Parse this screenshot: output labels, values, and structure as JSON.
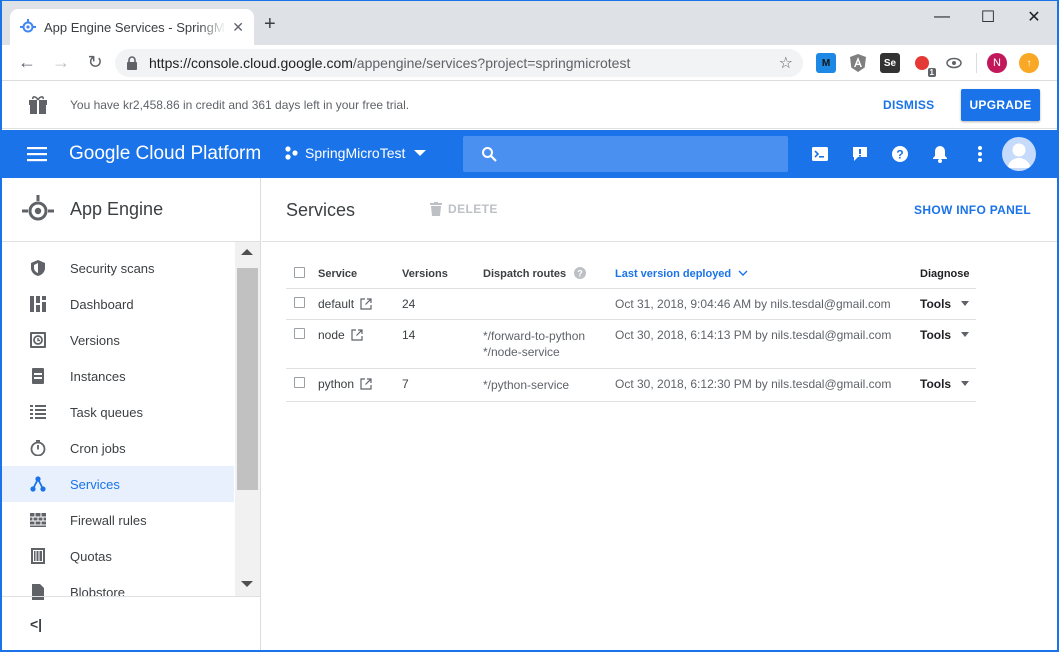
{
  "browser": {
    "tab_title": "App Engine Services - SpringMicroTest",
    "tab_close": "✕",
    "new_tab": "+",
    "url_host": "https://console.cloud.google.com",
    "url_path": "/appengine/services?project=springmicrotest",
    "extensions": [
      {
        "name": "M",
        "color": "#1e88e5"
      },
      {
        "name": "A",
        "color": "#616161"
      },
      {
        "name": "Se",
        "color": "#424242"
      },
      {
        "name": "1",
        "color": "#d32f2f"
      },
      {
        "name": "eye",
        "color": "#5f6368"
      },
      {
        "name": "N",
        "color": "#c2185b"
      },
      {
        "name": "up",
        "color": "#f9a825"
      }
    ],
    "profile_letter": "N",
    "ext_badge": "1",
    "ext_label_m": "M",
    "ext_label_se": "Se"
  },
  "trial": {
    "message": "You have kr2,458.86 in credit and 361 days left in your free trial.",
    "dismiss": "DISMISS",
    "upgrade": "UPGRADE"
  },
  "header": {
    "brand": "Google Cloud Platform",
    "project": "SpringMicroTest",
    "accent": "#1a73e8"
  },
  "sidebar": {
    "title": "App Engine",
    "items": [
      {
        "label": "Security scans",
        "icon": "shield-icon"
      },
      {
        "label": "Dashboard",
        "icon": "dashboard-icon"
      },
      {
        "label": "Versions",
        "icon": "versions-icon"
      },
      {
        "label": "Instances",
        "icon": "instances-icon"
      },
      {
        "label": "Task queues",
        "icon": "list-icon"
      },
      {
        "label": "Cron jobs",
        "icon": "timer-icon"
      },
      {
        "label": "Services",
        "icon": "services-icon",
        "active": true
      },
      {
        "label": "Firewall rules",
        "icon": "firewall-icon"
      },
      {
        "label": "Quotas",
        "icon": "quotas-icon"
      },
      {
        "label": "Blobstore",
        "icon": "blobstore-icon"
      }
    ],
    "collapse": "<|"
  },
  "main": {
    "title": "Services",
    "delete": "DELETE",
    "info_panel": "SHOW INFO PANEL",
    "columns": {
      "service": "Service",
      "versions": "Versions",
      "dispatch": "Dispatch routes",
      "deployed": "Last version deployed",
      "diagnose": "Diagnose"
    },
    "rows": [
      {
        "service": "default",
        "versions": "24",
        "routes": [
          "",
          ""
        ],
        "deployed": "Oct 31, 2018, 9:04:46 AM by nils.tesdal@gmail.com",
        "diagnose": "Tools"
      },
      {
        "service": "node",
        "versions": "14",
        "routes": [
          "*/forward-to-python",
          "*/node-service"
        ],
        "deployed": "Oct 30, 2018, 6:14:13 PM by nils.tesdal@gmail.com",
        "diagnose": "Tools"
      },
      {
        "service": "python",
        "versions": "7",
        "routes": [
          "*/python-service",
          ""
        ],
        "deployed": "Oct 30, 2018, 6:12:30 PM by nils.tesdal@gmail.com",
        "diagnose": "Tools"
      }
    ]
  }
}
